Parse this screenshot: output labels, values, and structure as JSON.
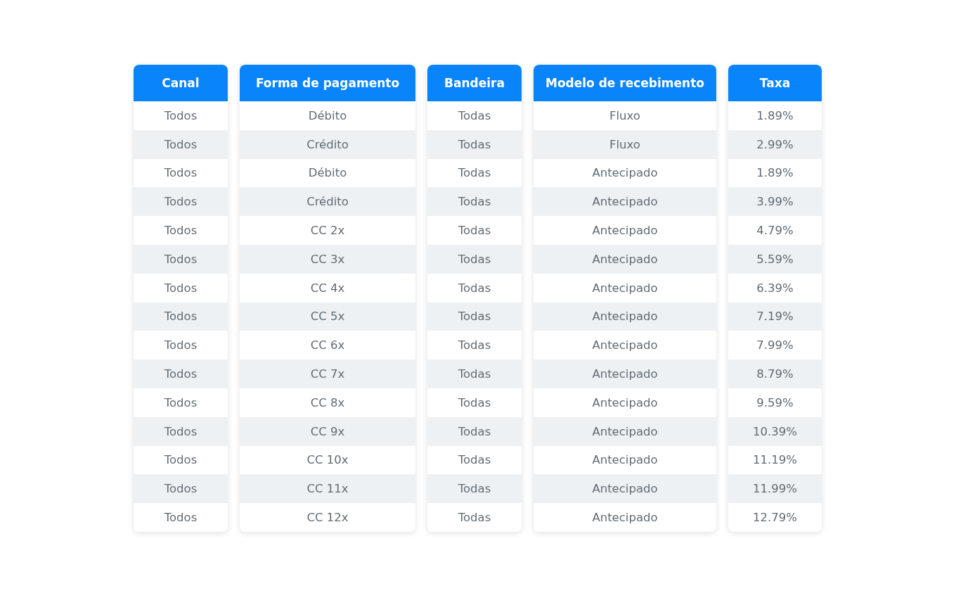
{
  "table": {
    "columns": [
      {
        "header": "Canal",
        "cells": [
          "Todos",
          "Todos",
          "Todos",
          "Todos",
          "Todos",
          "Todos",
          "Todos",
          "Todos",
          "Todos",
          "Todos",
          "Todos",
          "Todos",
          "Todos",
          "Todos",
          "Todos"
        ]
      },
      {
        "header": "Forma de pagamento",
        "cells": [
          "Débito",
          "Crédito",
          "Débito",
          "Crédito",
          "CC 2x",
          "CC 3x",
          "CC 4x",
          "CC 5x",
          "CC 6x",
          "CC 7x",
          "CC 8x",
          "CC 9x",
          "CC 10x",
          "CC 11x",
          "CC 12x"
        ]
      },
      {
        "header": "Bandeira",
        "cells": [
          "Todas",
          "Todas",
          "Todas",
          "Todas",
          "Todas",
          "Todas",
          "Todas",
          "Todas",
          "Todas",
          "Todas",
          "Todas",
          "Todas",
          "Todas",
          "Todas",
          "Todas"
        ]
      },
      {
        "header": "Modelo de recebimento",
        "cells": [
          "Fluxo",
          "Fluxo",
          "Antecipado",
          "Antecipado",
          "Antecipado",
          "Antecipado",
          "Antecipado",
          "Antecipado",
          "Antecipado",
          "Antecipado",
          "Antecipado",
          "Antecipado",
          "Antecipado",
          "Antecipado",
          "Antecipado"
        ]
      },
      {
        "header": "Taxa",
        "cells": [
          "1.89%",
          "2.99%",
          "1.89%",
          "3.99%",
          "4.79%",
          "5.59%",
          "6.39%",
          "7.19%",
          "7.99%",
          "8.79%",
          "9.59%",
          "10.39%",
          "11.19%",
          "11.99%",
          "12.79%"
        ]
      }
    ]
  }
}
